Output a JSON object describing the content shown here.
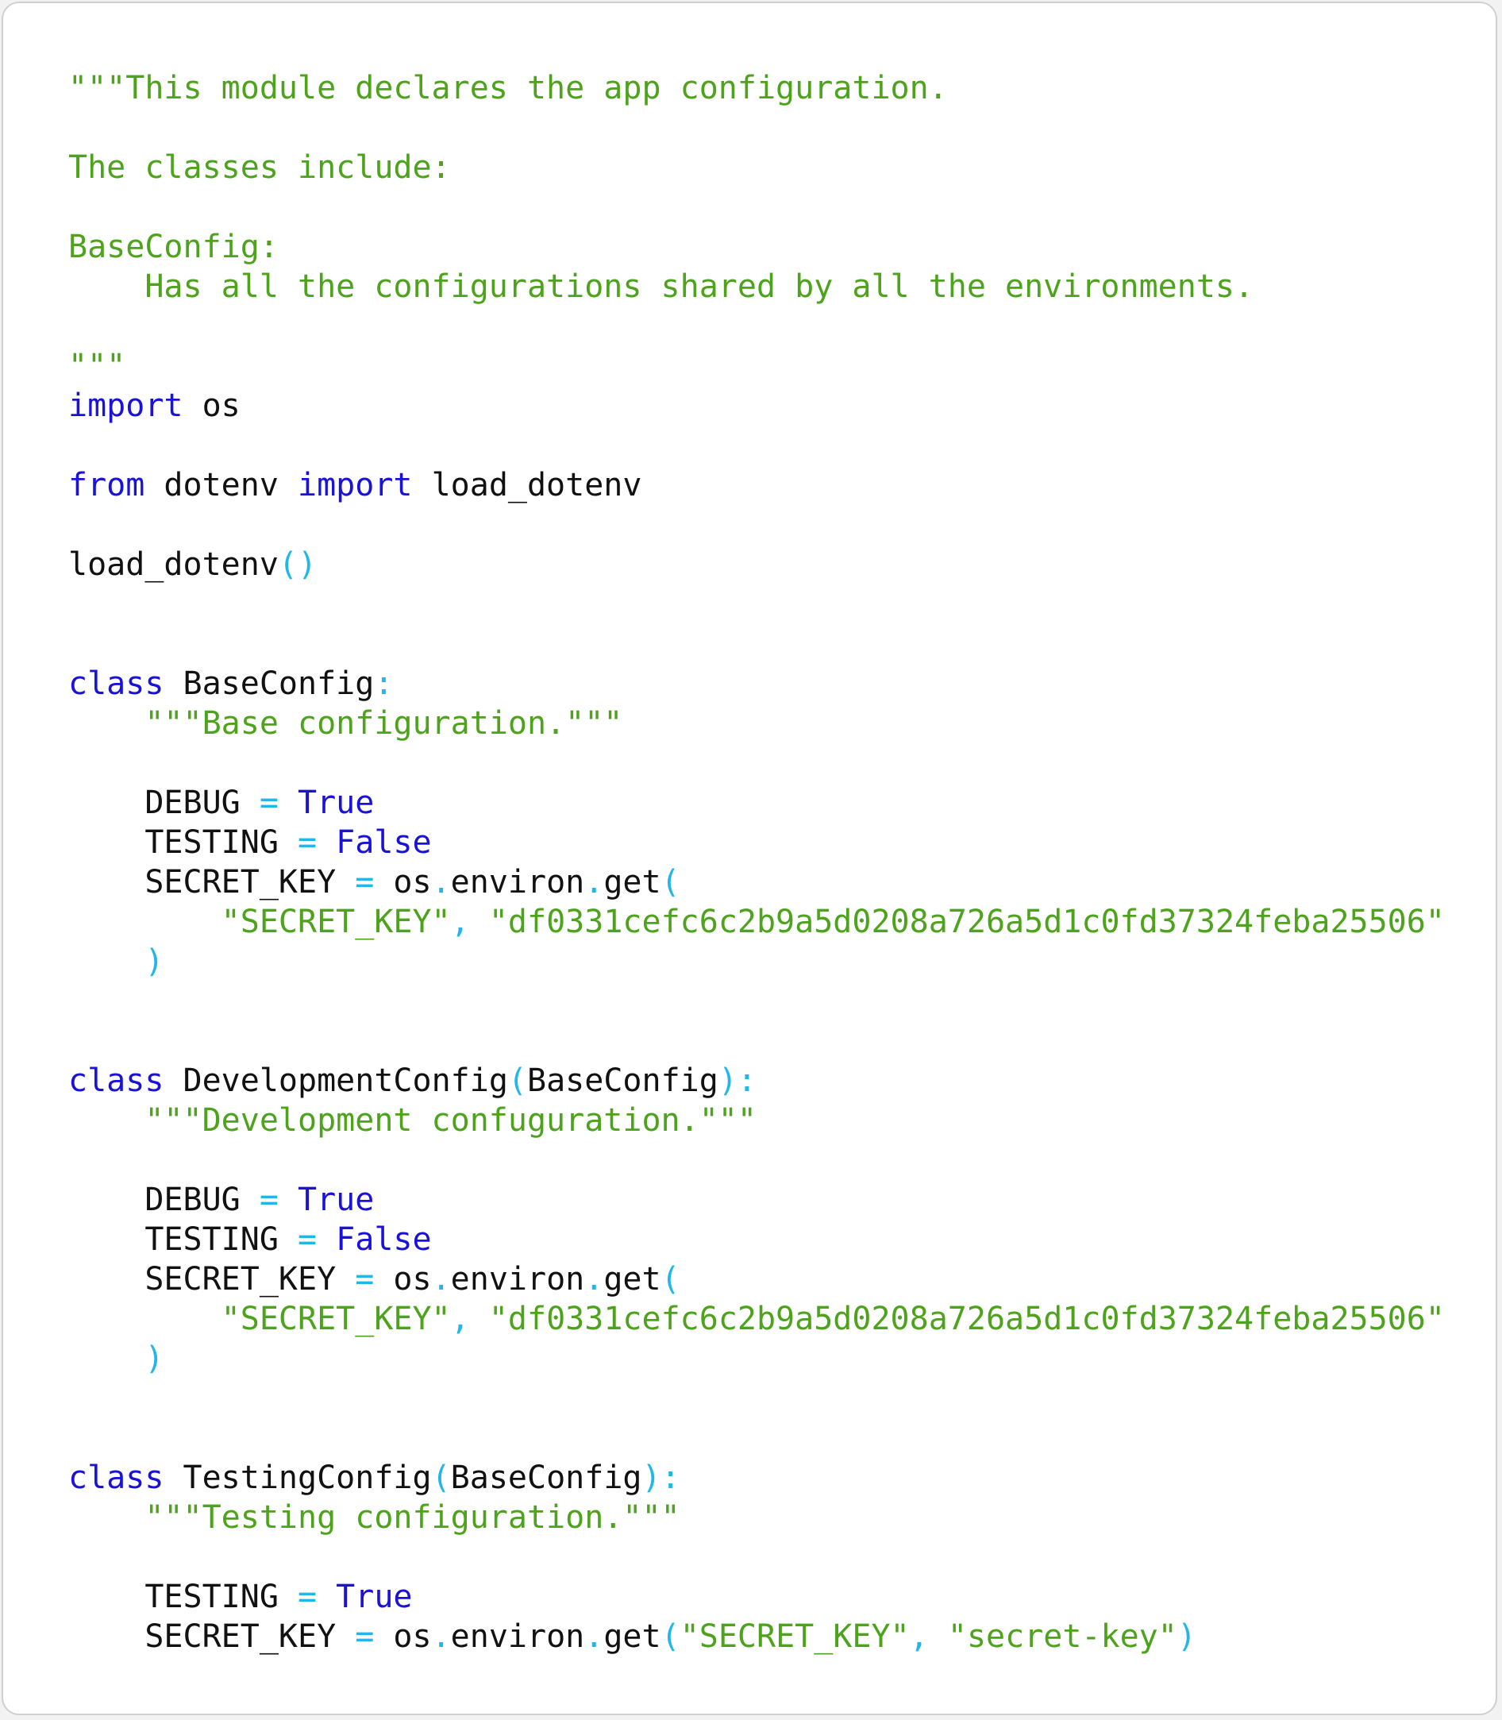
{
  "code_view": {
    "lines": [
      [
        {
          "t": "\"\"\"This module declares the app configuration.",
          "c": "doc"
        }
      ],
      [],
      [
        {
          "t": "The classes include:",
          "c": "doc"
        }
      ],
      [],
      [
        {
          "t": "BaseConfig:",
          "c": "doc"
        }
      ],
      [
        {
          "t": "    Has all the configurations shared by all the environments.",
          "c": "doc"
        }
      ],
      [],
      [
        {
          "t": "\"\"\"",
          "c": "doc"
        }
      ],
      [
        {
          "t": "import",
          "c": "kw"
        },
        {
          "t": " os",
          "c": "id"
        }
      ],
      [],
      [
        {
          "t": "from",
          "c": "kw"
        },
        {
          "t": " dotenv ",
          "c": "id"
        },
        {
          "t": "import",
          "c": "kw"
        },
        {
          "t": " load_dotenv",
          "c": "id"
        }
      ],
      [],
      [
        {
          "t": "load_dotenv",
          "c": "id"
        },
        {
          "t": "()",
          "c": "op"
        }
      ],
      [],
      [],
      [
        {
          "t": "class",
          "c": "kw"
        },
        {
          "t": " BaseConfig",
          "c": "id"
        },
        {
          "t": ":",
          "c": "op"
        }
      ],
      [
        {
          "t": "    ",
          "c": "id"
        },
        {
          "t": "\"\"\"Base configuration.\"\"\"",
          "c": "doc"
        }
      ],
      [],
      [
        {
          "t": "    DEBUG ",
          "c": "id"
        },
        {
          "t": "=",
          "c": "op"
        },
        {
          "t": " ",
          "c": "id"
        },
        {
          "t": "True",
          "c": "kw"
        }
      ],
      [
        {
          "t": "    TESTING ",
          "c": "id"
        },
        {
          "t": "=",
          "c": "op"
        },
        {
          "t": " ",
          "c": "id"
        },
        {
          "t": "False",
          "c": "kw"
        }
      ],
      [
        {
          "t": "    SECRET_KEY ",
          "c": "id"
        },
        {
          "t": "=",
          "c": "op"
        },
        {
          "t": " os",
          "c": "id"
        },
        {
          "t": ".",
          "c": "op"
        },
        {
          "t": "environ",
          "c": "id"
        },
        {
          "t": ".",
          "c": "op"
        },
        {
          "t": "get",
          "c": "id"
        },
        {
          "t": "(",
          "c": "op"
        }
      ],
      [
        {
          "t": "        ",
          "c": "id"
        },
        {
          "t": "\"SECRET_KEY\"",
          "c": "str"
        },
        {
          "t": ",",
          "c": "op"
        },
        {
          "t": " ",
          "c": "id"
        },
        {
          "t": "\"df0331cefc6c2b9a5d0208a726a5d1c0fd37324feba25506\"",
          "c": "str"
        }
      ],
      [
        {
          "t": "    ",
          "c": "id"
        },
        {
          "t": ")",
          "c": "op"
        }
      ],
      [],
      [],
      [
        {
          "t": "class",
          "c": "kw"
        },
        {
          "t": " DevelopmentConfig",
          "c": "id"
        },
        {
          "t": "(",
          "c": "op"
        },
        {
          "t": "BaseConfig",
          "c": "id"
        },
        {
          "t": "):",
          "c": "op"
        }
      ],
      [
        {
          "t": "    ",
          "c": "id"
        },
        {
          "t": "\"\"\"Development confuguration.\"\"\"",
          "c": "doc"
        }
      ],
      [],
      [
        {
          "t": "    DEBUG ",
          "c": "id"
        },
        {
          "t": "=",
          "c": "op"
        },
        {
          "t": " ",
          "c": "id"
        },
        {
          "t": "True",
          "c": "kw"
        }
      ],
      [
        {
          "t": "    TESTING ",
          "c": "id"
        },
        {
          "t": "=",
          "c": "op"
        },
        {
          "t": " ",
          "c": "id"
        },
        {
          "t": "False",
          "c": "kw"
        }
      ],
      [
        {
          "t": "    SECRET_KEY ",
          "c": "id"
        },
        {
          "t": "=",
          "c": "op"
        },
        {
          "t": " os",
          "c": "id"
        },
        {
          "t": ".",
          "c": "op"
        },
        {
          "t": "environ",
          "c": "id"
        },
        {
          "t": ".",
          "c": "op"
        },
        {
          "t": "get",
          "c": "id"
        },
        {
          "t": "(",
          "c": "op"
        }
      ],
      [
        {
          "t": "        ",
          "c": "id"
        },
        {
          "t": "\"SECRET_KEY\"",
          "c": "str"
        },
        {
          "t": ",",
          "c": "op"
        },
        {
          "t": " ",
          "c": "id"
        },
        {
          "t": "\"df0331cefc6c2b9a5d0208a726a5d1c0fd37324feba25506\"",
          "c": "str"
        }
      ],
      [
        {
          "t": "    ",
          "c": "id"
        },
        {
          "t": ")",
          "c": "op"
        }
      ],
      [],
      [],
      [
        {
          "t": "class",
          "c": "kw"
        },
        {
          "t": " TestingConfig",
          "c": "id"
        },
        {
          "t": "(",
          "c": "op"
        },
        {
          "t": "BaseConfig",
          "c": "id"
        },
        {
          "t": "):",
          "c": "op"
        }
      ],
      [
        {
          "t": "    ",
          "c": "id"
        },
        {
          "t": "\"\"\"Testing configuration.\"\"\"",
          "c": "doc"
        }
      ],
      [],
      [
        {
          "t": "    TESTING ",
          "c": "id"
        },
        {
          "t": "=",
          "c": "op"
        },
        {
          "t": " ",
          "c": "id"
        },
        {
          "t": "True",
          "c": "kw"
        }
      ],
      [
        {
          "t": "    SECRET_KEY ",
          "c": "id"
        },
        {
          "t": "=",
          "c": "op"
        },
        {
          "t": " os",
          "c": "id"
        },
        {
          "t": ".",
          "c": "op"
        },
        {
          "t": "environ",
          "c": "id"
        },
        {
          "t": ".",
          "c": "op"
        },
        {
          "t": "get",
          "c": "id"
        },
        {
          "t": "(",
          "c": "op"
        },
        {
          "t": "\"SECRET_KEY\"",
          "c": "str"
        },
        {
          "t": ",",
          "c": "op"
        },
        {
          "t": " ",
          "c": "id"
        },
        {
          "t": "\"secret-key\"",
          "c": "str"
        },
        {
          "t": ")",
          "c": "op"
        }
      ]
    ]
  }
}
